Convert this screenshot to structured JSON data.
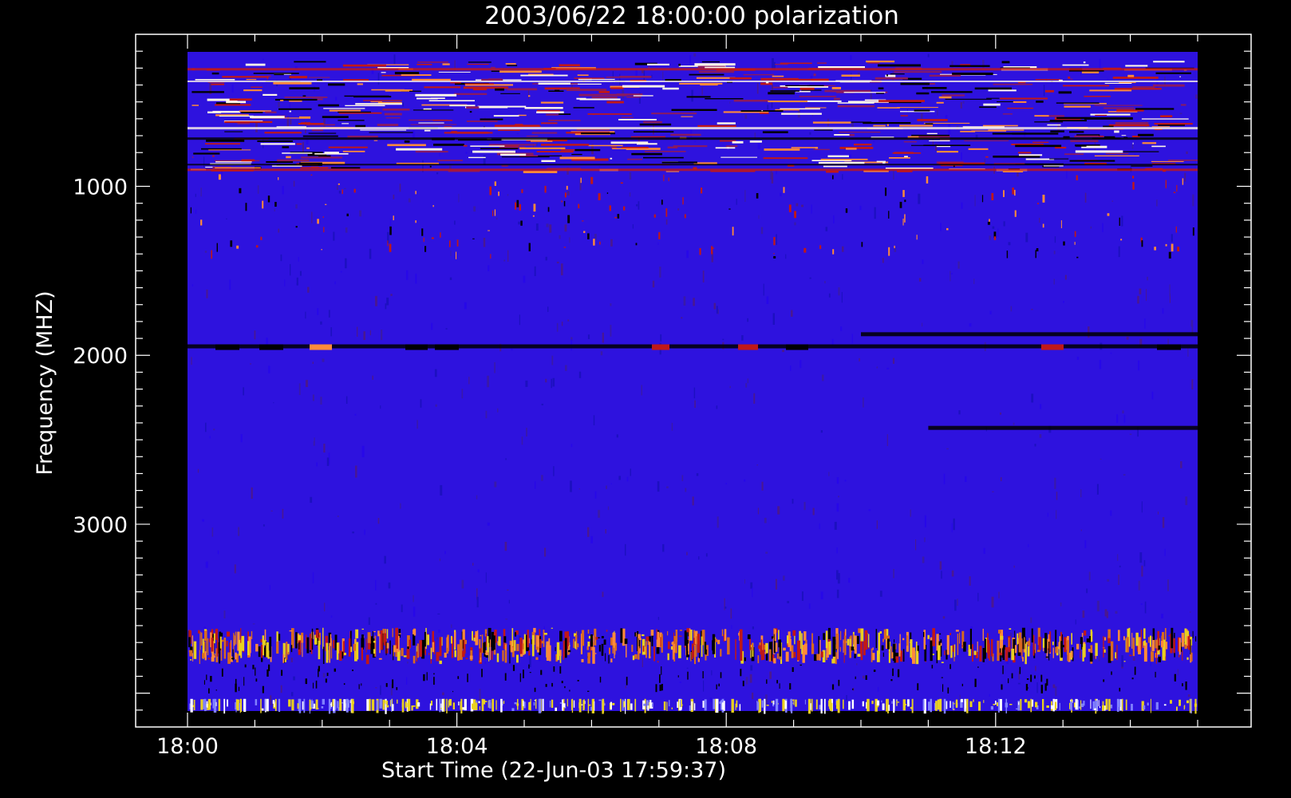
{
  "chart_data": {
    "type": "heatmap",
    "title": "2003/06/22 18:00:00 polarization",
    "xlabel": "Start Time (22-Jun-03 17:59:37)",
    "ylabel": "Frequency (MHZ)",
    "x_tick_labels": [
      "18:00",
      "18:04",
      "18:08",
      "18:12"
    ],
    "y_tick_labels": [
      "1000",
      "2000",
      "3000"
    ],
    "y_tick_values": [
      1000,
      2000,
      3000
    ],
    "y_axis_reversed": true,
    "ylim": [
      100,
      4200
    ],
    "data_time_range": [
      "18:00",
      "18:15"
    ],
    "data_freq_range": [
      200,
      4000
    ],
    "colors": {
      "background": "#000000",
      "axes": "#ffffff",
      "base": "#2e12de",
      "dark": "#000000",
      "red": "#c01818",
      "orange": "#ff8a3a",
      "yellow": "#e8d020",
      "white": "#fff6e8"
    },
    "features": [
      {
        "name": "interference band",
        "freq_range": [
          300,
          900
        ],
        "color": "red"
      },
      {
        "name": "dark line",
        "freq": 1830,
        "time_range": [
          "18:10",
          "18:15"
        ],
        "color": "dark"
      },
      {
        "name": "dark/orange streak",
        "freq": 1900,
        "time_range": [
          "18:00",
          "18:15"
        ],
        "color": "dark"
      },
      {
        "name": "dark line",
        "freq": 2370,
        "time_range": [
          "18:11",
          "18:15"
        ],
        "color": "dark"
      },
      {
        "name": "bright band",
        "freq_range": [
          3520,
          3730
        ],
        "color": "orange"
      },
      {
        "name": "yellow band",
        "freq_range": [
          3930,
          4000
        ],
        "color": "yellow"
      }
    ]
  }
}
